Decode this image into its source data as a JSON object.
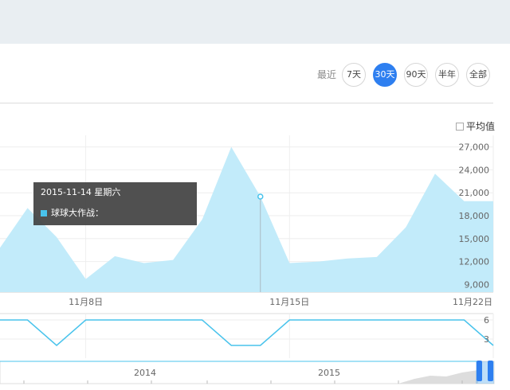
{
  "range": {
    "label": "最近",
    "options": [
      {
        "label": "7天",
        "active": false
      },
      {
        "label": "30天",
        "active": true
      },
      {
        "label": "90天",
        "active": false
      },
      {
        "label": "半年",
        "active": false
      },
      {
        "label": "全部",
        "active": false
      }
    ]
  },
  "avg_toggle": {
    "label": "平均值",
    "checked": false
  },
  "tooltip": {
    "date": "2015-11-14 星期六",
    "series_name": "球球大作战",
    "series_value_label": "球球大作战："
  },
  "colors": {
    "accent": "#2e7ff0",
    "area_fill": "#c2ebfa",
    "line": "#49c3ec"
  },
  "chart_data": [
    {
      "type": "area",
      "x": [
        "2015-11-05",
        "2015-11-06",
        "2015-11-07",
        "2015-11-08",
        "2015-11-09",
        "2015-11-10",
        "2015-11-11",
        "2015-11-12",
        "2015-11-13",
        "2015-11-14",
        "2015-11-15",
        "2015-11-16",
        "2015-11-17",
        "2015-11-18",
        "2015-11-19",
        "2015-11-20",
        "2015-11-21",
        "2015-11-22"
      ],
      "series": [
        {
          "name": "球球大作战",
          "values": [
            13500,
            19000,
            15200,
            9700,
            12700,
            11800,
            12200,
            17500,
            27000,
            20500,
            11800,
            12000,
            12400,
            12600,
            16500,
            23500,
            19900,
            19900
          ]
        }
      ],
      "xtick_labels": [
        "11月8日",
        "11月15日",
        "11月22日"
      ],
      "ytick_labels": [
        "9,000",
        "12,000",
        "15,000",
        "18,000",
        "21,000",
        "24,000",
        "27,000"
      ],
      "ylim": [
        8000,
        28000
      ],
      "highlight": "2015-11-14",
      "grid": true
    },
    {
      "type": "line",
      "x": [
        "2015-11-05",
        "2015-11-06",
        "2015-11-07",
        "2015-11-08",
        "2015-11-09",
        "2015-11-10",
        "2015-11-11",
        "2015-11-12",
        "2015-11-13",
        "2015-11-14",
        "2015-11-15",
        "2015-11-16",
        "2015-11-17",
        "2015-11-18",
        "2015-11-19",
        "2015-11-20",
        "2015-11-21",
        "2015-11-22"
      ],
      "series": [
        {
          "values": [
            6,
            6,
            2,
            6,
            6,
            6,
            6,
            6,
            2,
            2,
            6,
            6,
            6,
            6,
            6,
            6,
            6,
            2
          ]
        }
      ],
      "ytick_labels": [
        "3",
        "6"
      ],
      "ylim": [
        0,
        7
      ]
    },
    {
      "type": "area",
      "role": "navigator",
      "xtick_labels": [
        "2014",
        "2015"
      ]
    }
  ]
}
